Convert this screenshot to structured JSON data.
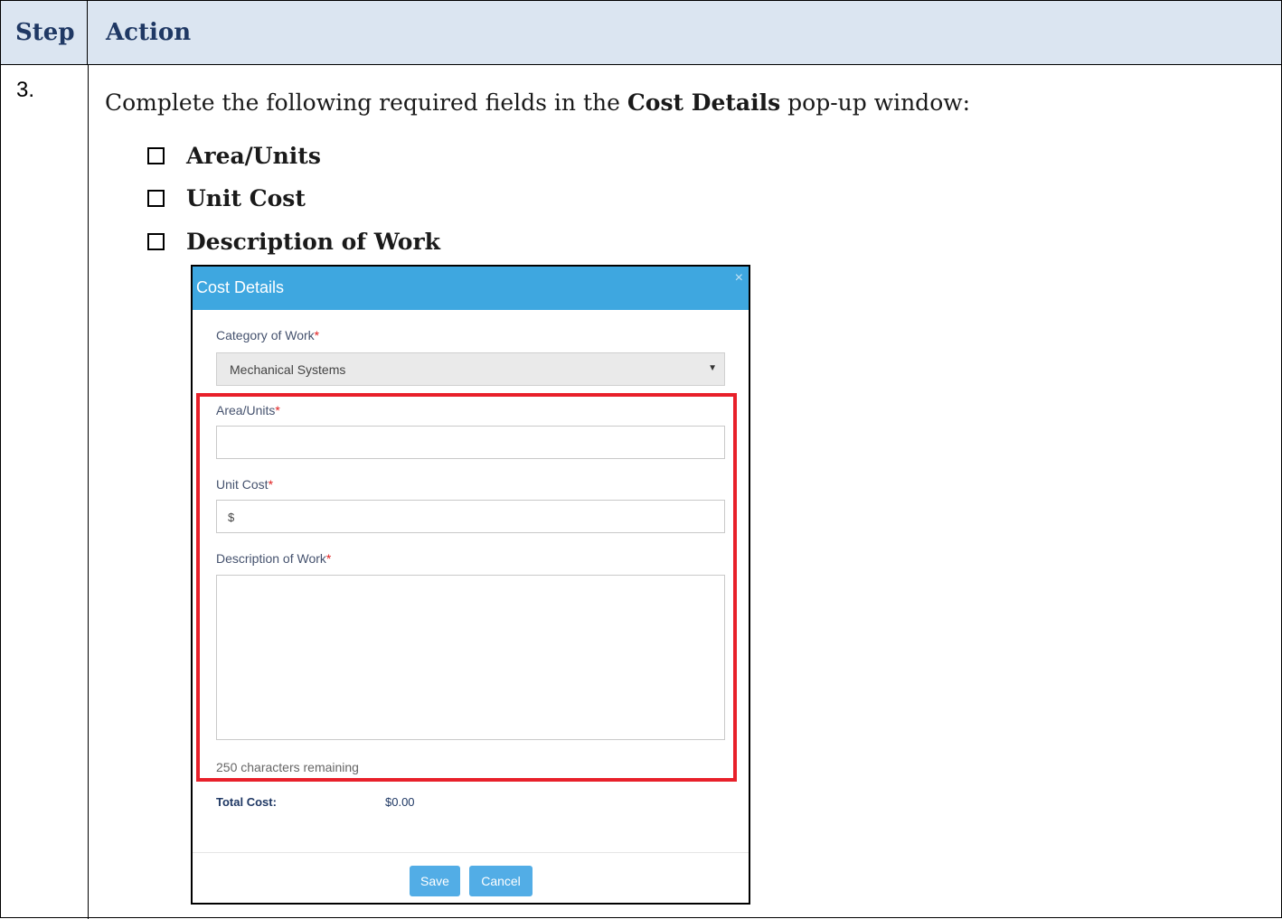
{
  "table": {
    "header_step": "Step",
    "header_action": "Action"
  },
  "step": {
    "number": "3.",
    "instruction_before": "Complete the following required fields in the ",
    "instruction_bold": "Cost Details",
    "instruction_after": " pop-up window:",
    "checklist": [
      "Area/Units",
      "Unit Cost",
      "Description of Work"
    ]
  },
  "modal": {
    "title": "Cost Details",
    "close_glyph": "×",
    "category_label": "Category of Work",
    "category_value": "Mechanical Systems",
    "required_marker": "*",
    "area_label": "Area/Units",
    "area_value": "",
    "unit_cost_label": "Unit Cost",
    "unit_cost_value": "$",
    "description_label": "Description of Work",
    "description_value": "",
    "remaining_text": "250 characters remaining",
    "total_label": "Total Cost:",
    "total_value": "$0.00",
    "save_label": "Save",
    "cancel_label": "Cancel",
    "highlight_color": "#e8202a",
    "header_color": "#3ea7e0"
  }
}
